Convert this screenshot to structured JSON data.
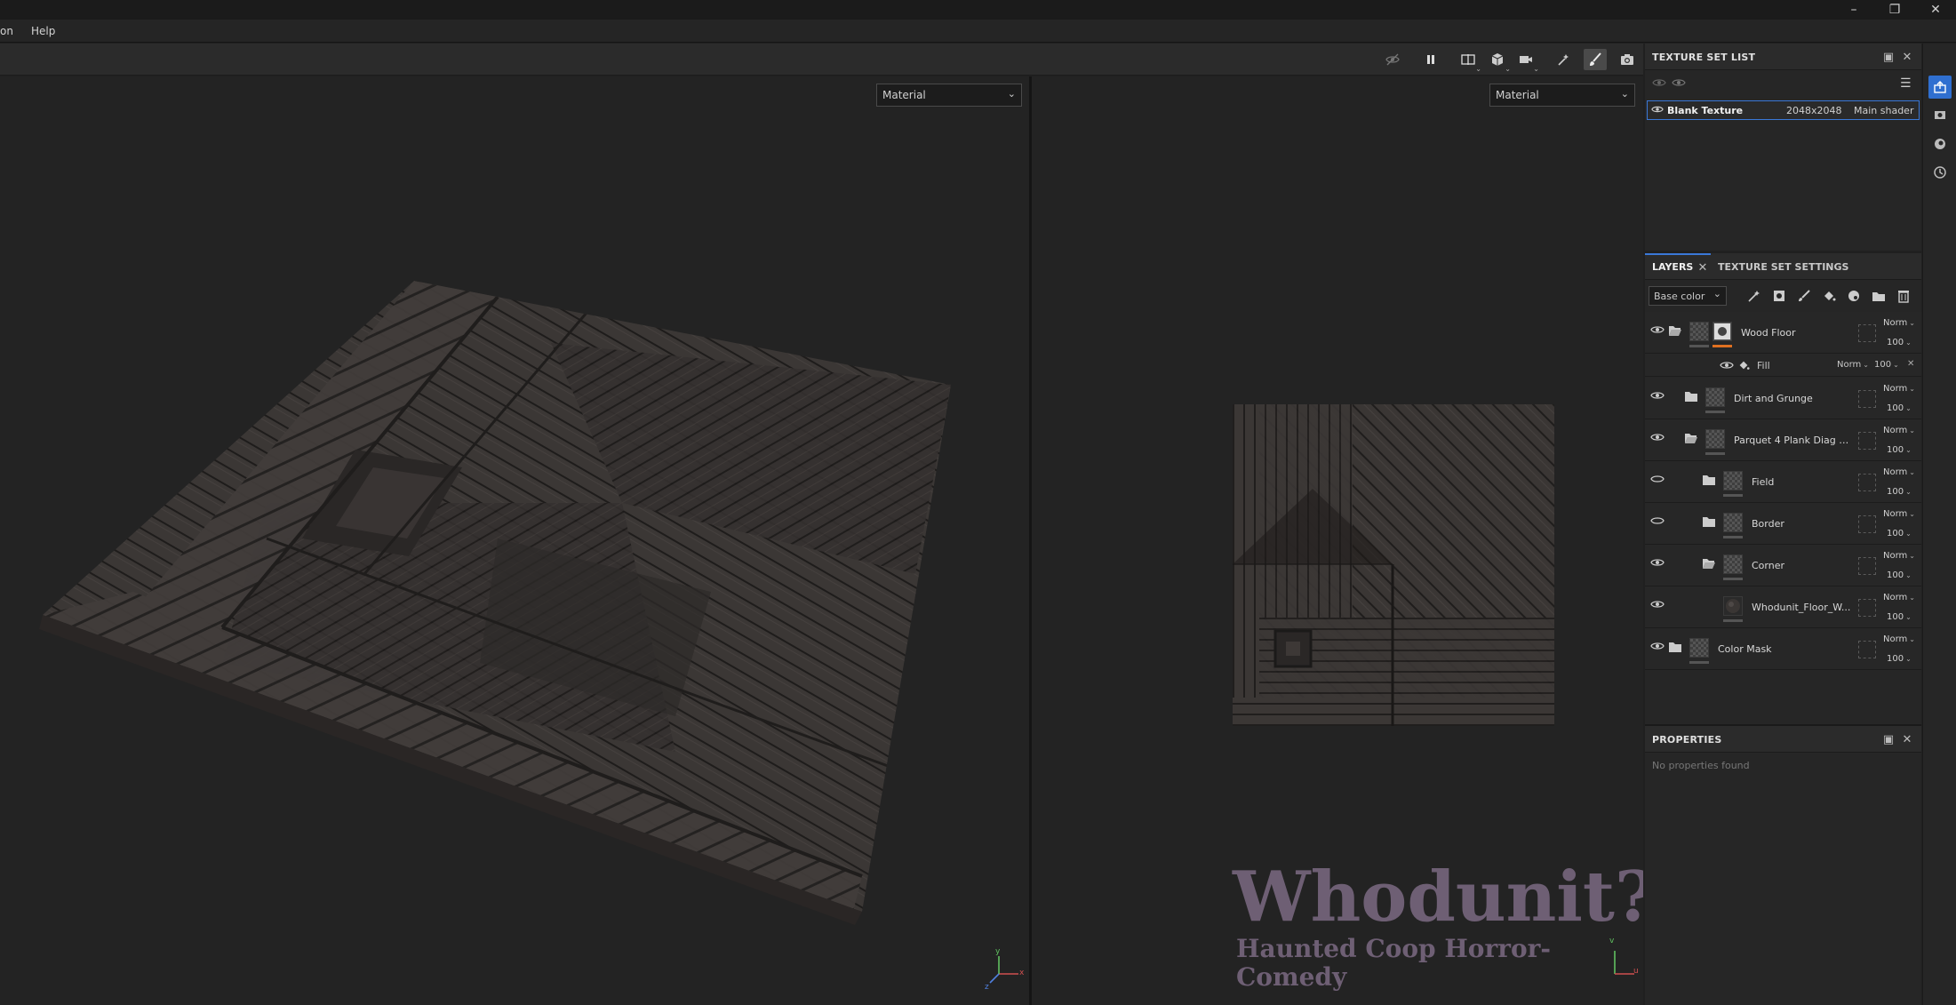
{
  "menu": {
    "items": [
      "on",
      "Help"
    ]
  },
  "viewports": {
    "left_select": "Material",
    "right_select": "Material"
  },
  "texture_set_list": {
    "title": "TEXTURE SET LIST",
    "row": {
      "name": "Blank Texture",
      "resolution": "2048x2048",
      "shader": "Main shader"
    }
  },
  "layers_panel": {
    "tabs": [
      "LAYERS",
      "TEXTURE SET SETTINGS"
    ],
    "channel_select": "Base color",
    "fill": {
      "label": "Fill",
      "blend": "Norm",
      "opacity": "100"
    },
    "layers": [
      {
        "name": "Wood Floor",
        "blend": "Norm",
        "opacity": "100"
      },
      {
        "name": "Dirt and Grunge",
        "blend": "Norm",
        "opacity": "100"
      },
      {
        "name": "Parquet 4 Plank Diag Sq...",
        "blend": "Norm",
        "opacity": "100"
      },
      {
        "name": "Field",
        "blend": "Norm",
        "opacity": "100"
      },
      {
        "name": "Border",
        "blend": "Norm",
        "opacity": "100"
      },
      {
        "name": "Corner",
        "blend": "Norm",
        "opacity": "100"
      },
      {
        "name": "Whodunit_Floor_W...",
        "blend": "Norm",
        "opacity": "100"
      },
      {
        "name": "Color Mask",
        "blend": "Norm",
        "opacity": "100"
      }
    ]
  },
  "properties": {
    "title": "PROPERTIES",
    "empty_text": "No properties found"
  },
  "watermark": {
    "title": "Whodunit?",
    "subtitle": "Haunted Coop Horror-Comedy"
  },
  "axis": {
    "x": "x",
    "y": "y",
    "z": "z",
    "u": "u",
    "v": "v"
  },
  "colors": {
    "accent": "#3a78d8",
    "orange_mark": "#e07020",
    "watermark": "#7a6a80"
  }
}
